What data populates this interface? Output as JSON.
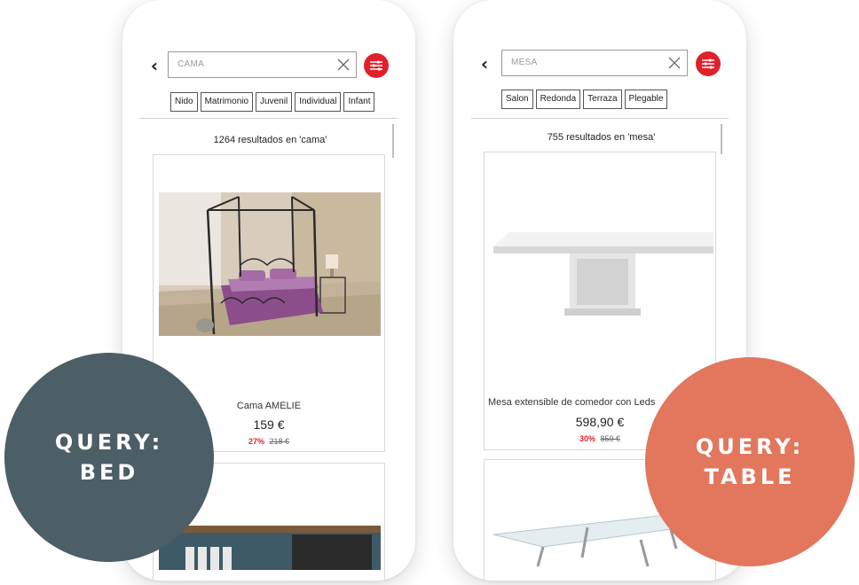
{
  "left_phone": {
    "search_value": "CAMA",
    "chips": [
      "Nido",
      "Matrimonio",
      "Juvenil",
      "Individual",
      "Infant"
    ],
    "results_count": "1264 resultados en 'cama'",
    "product": {
      "title": "Cama AMELIE",
      "price": "159 €",
      "discount": "27%",
      "old_price": "218 €"
    }
  },
  "right_phone": {
    "search_value": "MESA",
    "chips": [
      "Salon",
      "Redonda",
      "Terraza",
      "Plegable"
    ],
    "results_count": "755 resultados en 'mesa'",
    "product": {
      "title": "Mesa extensible de comedor con Leds",
      "price": "598,90 €",
      "discount": "30%",
      "old_price": "859 €"
    }
  },
  "badges": {
    "bed": {
      "line1": "QUERY:",
      "line2": "BED",
      "color": "#4c5e66"
    },
    "table": {
      "line1": "QUERY:",
      "line2": "TABLE",
      "color": "#e2775e"
    }
  },
  "colors": {
    "accent": "#e0202a"
  },
  "icons": {
    "back": "chevron-left-icon",
    "clear": "close-icon",
    "filter": "sliders-icon"
  }
}
